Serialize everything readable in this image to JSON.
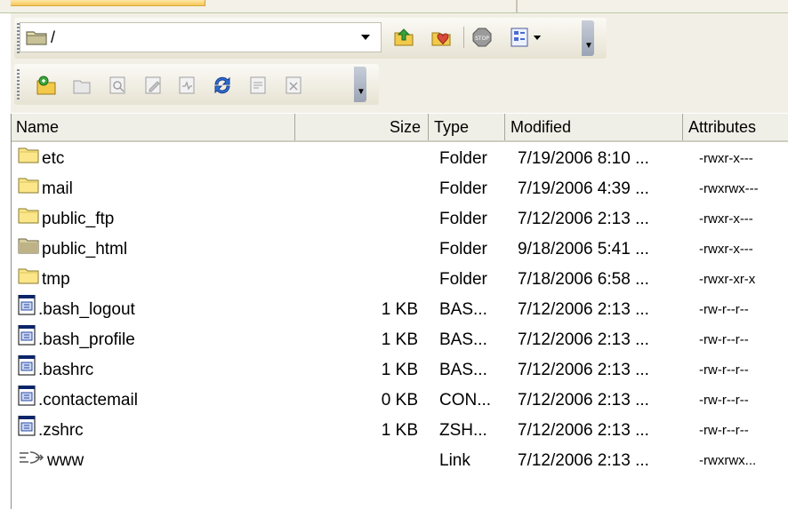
{
  "path": {
    "value": "/"
  },
  "columns": {
    "name": "Name",
    "size": "Size",
    "type": "Type",
    "modified": "Modified",
    "attributes": "Attributes"
  },
  "files": [
    {
      "icon": "folder-icon",
      "name": "etc",
      "size": "",
      "type": "Folder",
      "modified": "7/19/2006 8:10 ...",
      "attributes": "-rwxr-x---"
    },
    {
      "icon": "folder-icon",
      "name": "mail",
      "size": "",
      "type": "Folder",
      "modified": "7/19/2006 4:39 ...",
      "attributes": "-rwxrwx---"
    },
    {
      "icon": "folder-icon",
      "name": "public_ftp",
      "size": "",
      "type": "Folder",
      "modified": "7/12/2006 2:13 ...",
      "attributes": "-rwxr-x---"
    },
    {
      "icon": "web-folder-icon",
      "name": "public_html",
      "size": "",
      "type": "Folder",
      "modified": "9/18/2006 5:41 ...",
      "attributes": "-rwxr-x---"
    },
    {
      "icon": "folder-icon",
      "name": "tmp",
      "size": "",
      "type": "Folder",
      "modified": "7/18/2006 6:58 ...",
      "attributes": "-rwxr-xr-x"
    },
    {
      "icon": "file-icon",
      "name": ".bash_logout",
      "size": "1 KB",
      "type": "BAS...",
      "modified": "7/12/2006 2:13 ...",
      "attributes": "-rw-r--r--"
    },
    {
      "icon": "file-icon",
      "name": ".bash_profile",
      "size": "1 KB",
      "type": "BAS...",
      "modified": "7/12/2006 2:13 ...",
      "attributes": "-rw-r--r--"
    },
    {
      "icon": "file-icon",
      "name": ".bashrc",
      "size": "1 KB",
      "type": "BAS...",
      "modified": "7/12/2006 2:13 ...",
      "attributes": "-rw-r--r--"
    },
    {
      "icon": "file-icon",
      "name": ".contactemail",
      "size": "0 KB",
      "type": "CON...",
      "modified": "7/12/2006 2:13 ...",
      "attributes": "-rw-r--r--"
    },
    {
      "icon": "file-icon",
      "name": ".zshrc",
      "size": "1 KB",
      "type": "ZSH...",
      "modified": "7/12/2006 2:13 ...",
      "attributes": "-rw-r--r--"
    },
    {
      "icon": "link-icon",
      "name": "www",
      "size": "",
      "type": "Link",
      "modified": "7/12/2006 2:13 ...",
      "attributes": "-rwxrwx..."
    }
  ],
  "toolbar1": [
    "parent-folder-icon",
    "favorites-icon",
    "stop-icon",
    "view-options-icon"
  ],
  "toolbar2": [
    "new-folder-icon",
    "open-icon",
    "view-file-icon",
    "edit-file-icon",
    "properties-icon",
    "refresh-icon",
    "upload-icon",
    "delete-icon"
  ]
}
